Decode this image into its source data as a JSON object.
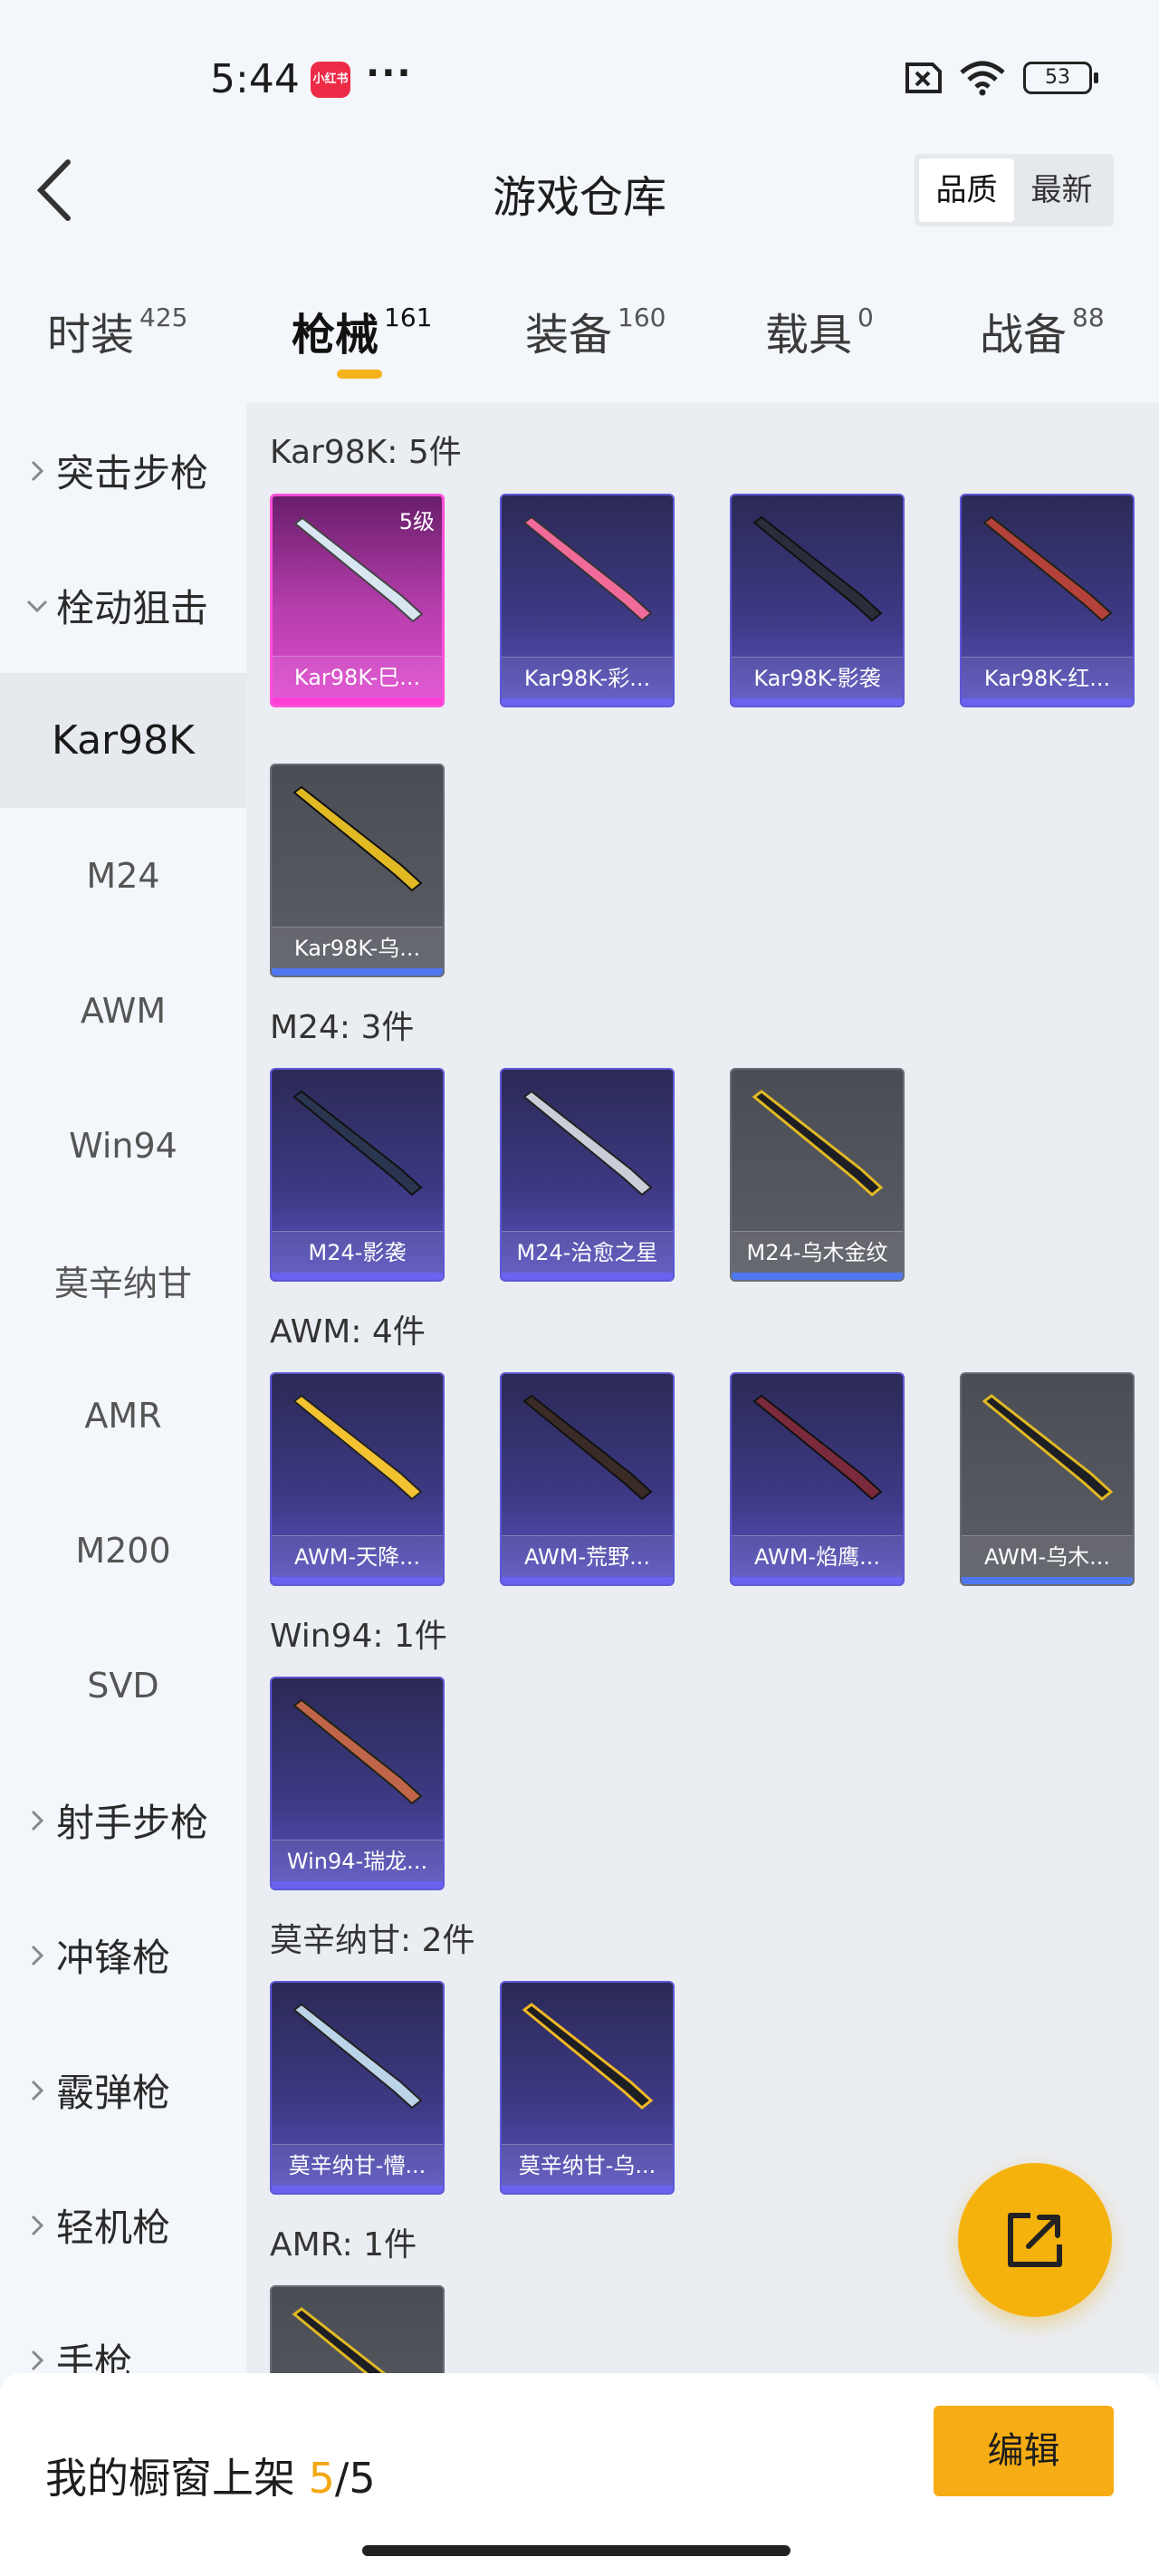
{
  "status_bar": {
    "time": "5:44",
    "app_badge": "小红书",
    "more": "···",
    "battery": "53",
    "icons": [
      "sim-off-icon",
      "wifi-icon",
      "battery-icon"
    ]
  },
  "header": {
    "title": "游戏仓库",
    "sort": {
      "quality": "品质",
      "newest": "最新",
      "selected": "品质"
    }
  },
  "tabs": [
    {
      "label": "时装",
      "count": "425"
    },
    {
      "label": "枪械",
      "count": "161",
      "active": true
    },
    {
      "label": "装备",
      "count": "160"
    },
    {
      "label": "载具",
      "count": "0"
    },
    {
      "label": "战备",
      "count": "88"
    }
  ],
  "sidebar": {
    "groups": {
      "assault": "突击步枪",
      "bolt": "栓动狙击",
      "marksman": "射手步枪",
      "smg": "冲锋枪",
      "shotgun": "霰弹枪",
      "lmg": "轻机枪",
      "pistol": "手枪"
    },
    "subs": [
      "Kar98K",
      "M24",
      "AWM",
      "Win94",
      "莫辛纳甘",
      "AMR",
      "M200",
      "SVD"
    ],
    "active_sub": "Kar98K"
  },
  "sections": [
    {
      "header": "Kar98K: 5件",
      "items": [
        {
          "name": "Kar98K-巳...",
          "rarity": "pink",
          "level": "5级"
        },
        {
          "name": "Kar98K-彩...",
          "rarity": "blue"
        },
        {
          "name": "Kar98K-影袭",
          "rarity": "blue"
        },
        {
          "name": "Kar98K-红...",
          "rarity": "blue"
        },
        {
          "name": "Kar98K-乌...",
          "rarity": "grey"
        }
      ]
    },
    {
      "header": "M24: 3件",
      "items": [
        {
          "name": "M24-影袭",
          "rarity": "blue"
        },
        {
          "name": "M24-治愈之星",
          "rarity": "blue"
        },
        {
          "name": "M24-乌木金纹",
          "rarity": "grey"
        }
      ]
    },
    {
      "header": "AWM: 4件",
      "items": [
        {
          "name": "AWM-天降...",
          "rarity": "blue"
        },
        {
          "name": "AWM-荒野...",
          "rarity": "blue"
        },
        {
          "name": "AWM-焰鹰...",
          "rarity": "blue"
        },
        {
          "name": "AWM-乌木...",
          "rarity": "grey"
        }
      ]
    },
    {
      "header": "Win94: 1件",
      "items": [
        {
          "name": "Win94-瑞龙...",
          "rarity": "blue"
        }
      ]
    },
    {
      "header": "莫辛纳甘: 2件",
      "items": [
        {
          "name": "莫辛纳甘-懵...",
          "rarity": "blue"
        },
        {
          "name": "莫辛纳甘-乌...",
          "rarity": "blue"
        }
      ]
    },
    {
      "header": "AMR: 1件",
      "items": [
        {
          "name": "",
          "rarity": "grey"
        }
      ]
    }
  ],
  "bottom": {
    "shelf_label": "我的橱窗上架",
    "shelf_count": "5",
    "shelf_total": "/5",
    "edit": "编辑"
  },
  "colors": {
    "accent": "#f6ad15",
    "rarity_blue": "#5f58d8",
    "rarity_pink": "#ff4fd8",
    "rarity_grey": "#5c5e66"
  }
}
